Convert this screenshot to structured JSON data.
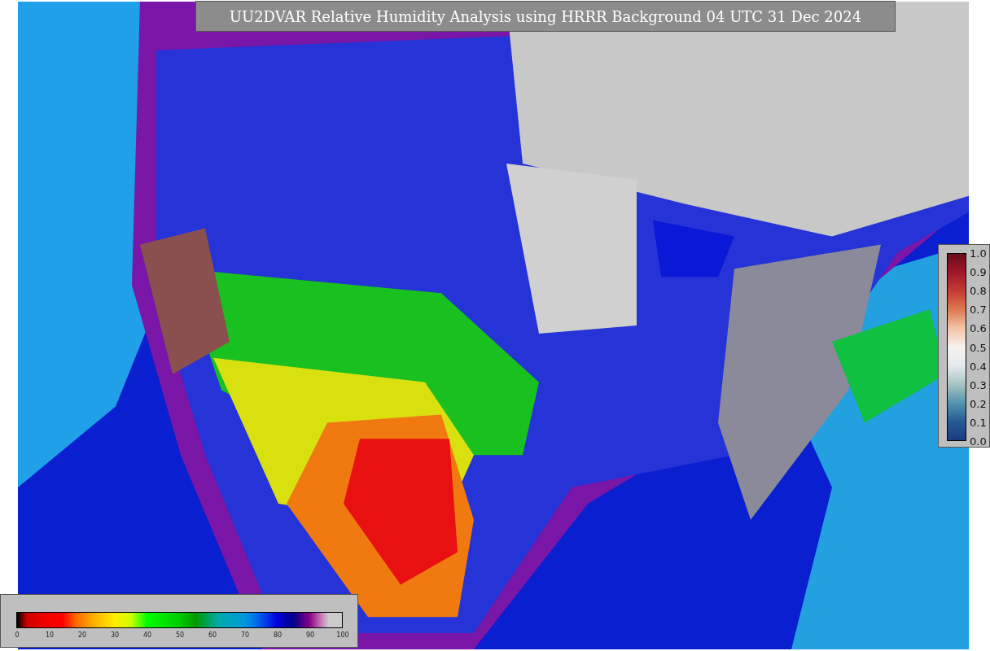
{
  "title": "UU2DVAR Relative Humidity Analysis using HRRR Background 04 UTC 31 Dec 2024",
  "humidity_colorbar": {
    "ticks": [
      "0",
      "10",
      "20",
      "30",
      "40",
      "50",
      "60",
      "70",
      "80",
      "90",
      "100"
    ]
  },
  "ratio_colorbar": {
    "ticks": [
      "1.0",
      "0.9",
      "0.8",
      "0.7",
      "0.6",
      "0.5",
      "0.4",
      "0.3",
      "0.2",
      "0.1",
      "0.0"
    ]
  }
}
